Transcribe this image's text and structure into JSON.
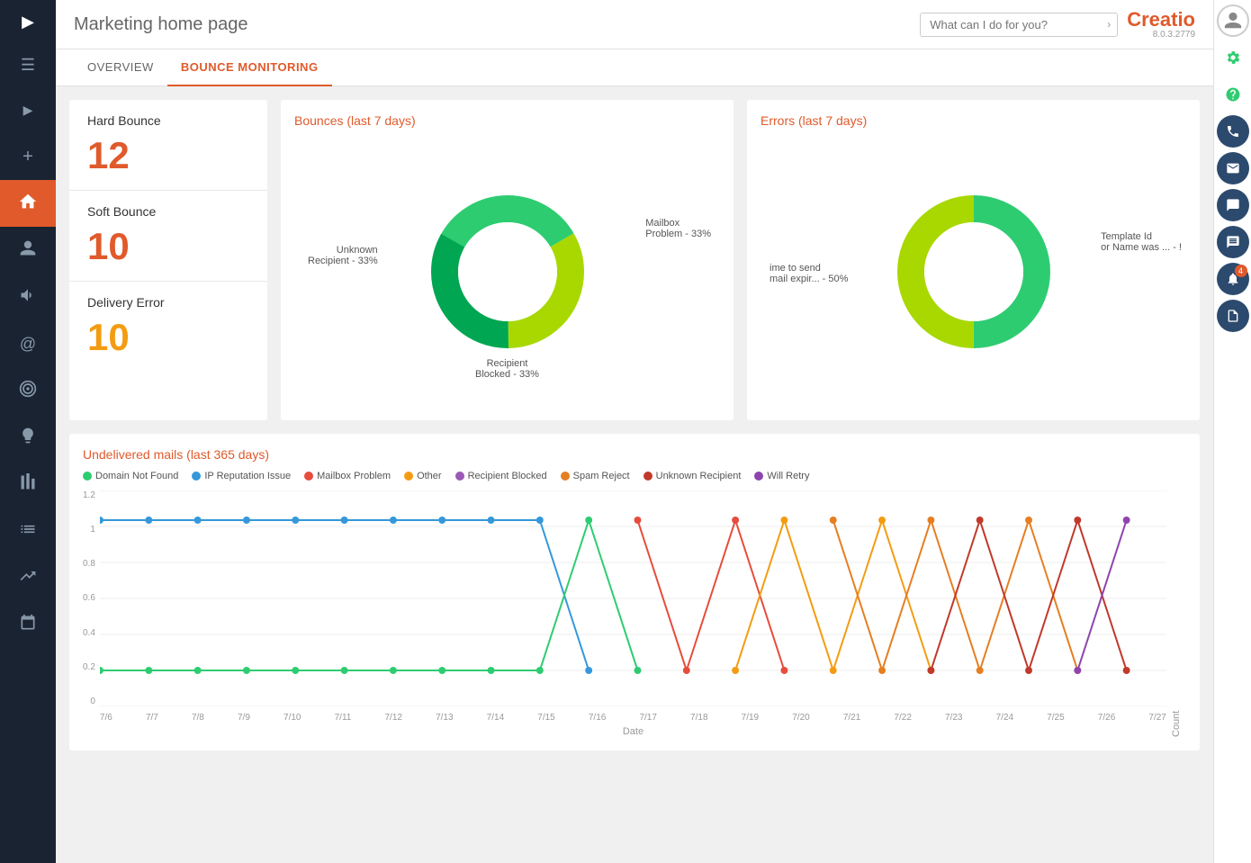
{
  "header": {
    "title": "Marketing home page",
    "search_placeholder": "What can I do for you?",
    "logo": "Creatio",
    "version": "8.0.3.2779"
  },
  "tabs": [
    {
      "label": "OVERVIEW",
      "active": false
    },
    {
      "label": "BOUNCE MONITORING",
      "active": true
    }
  ],
  "stats": [
    {
      "label": "Hard Bounce",
      "value": "12",
      "color": "red"
    },
    {
      "label": "Soft Bounce",
      "value": "10",
      "color": "red"
    },
    {
      "label": "Delivery Error",
      "value": "10",
      "color": "orange"
    }
  ],
  "bounces_chart": {
    "title": "Bounces (last 7 days)",
    "segments": [
      {
        "label": "Unknown Recipient - 33%",
        "color": "#2ecc71",
        "pct": 33
      },
      {
        "label": "Mailbox Problem - 33%",
        "color": "#a8d800",
        "pct": 33
      },
      {
        "label": "Recipient Blocked - 33%",
        "color": "#00a651",
        "pct": 34
      }
    ]
  },
  "errors_chart": {
    "title": "Errors (last 7 days)",
    "segments": [
      {
        "label": "ime to send mail expir... - 50%",
        "color": "#2ecc71",
        "pct": 50
      },
      {
        "label": "Template Id or Name was ... - !",
        "color": "#a8d800",
        "pct": 50
      }
    ]
  },
  "undelivered_chart": {
    "title": "Undelivered mails (last 365 days)",
    "y_label": "Count",
    "x_label": "Date",
    "y_ticks": [
      "0",
      "0.2",
      "0.4",
      "0.6",
      "0.8",
      "1",
      "1.2"
    ],
    "x_ticks": [
      "7/6",
      "7/7",
      "7/8",
      "7/9",
      "7/10",
      "7/11",
      "7/12",
      "7/13",
      "7/14",
      "7/15",
      "7/16",
      "7/17",
      "7/18",
      "7/19",
      "7/20",
      "7/21",
      "7/22",
      "7/23",
      "7/24",
      "7/25",
      "7/26",
      "7/27"
    ],
    "legend": [
      {
        "label": "Domain Not Found",
        "color": "#2ecc71"
      },
      {
        "label": "IP Reputation Issue",
        "color": "#3498db"
      },
      {
        "label": "Mailbox Problem",
        "color": "#e74c3c"
      },
      {
        "label": "Other",
        "color": "#f39c12"
      },
      {
        "label": "Recipient Blocked",
        "color": "#9b59b6"
      },
      {
        "label": "Spam Reject",
        "color": "#e67e22"
      },
      {
        "label": "Unknown Recipient",
        "color": "#c0392b"
      },
      {
        "label": "Will Retry",
        "color": "#8e44ad"
      }
    ]
  },
  "sidebar": {
    "items": [
      {
        "icon": "▶",
        "label": "expand"
      },
      {
        "icon": "☰",
        "label": "menu"
      },
      {
        "icon": "▶",
        "label": "play"
      },
      {
        "icon": "+",
        "label": "add"
      },
      {
        "icon": "⌂",
        "label": "home",
        "active": true
      },
      {
        "icon": "👤",
        "label": "user"
      },
      {
        "icon": "📢",
        "label": "marketing"
      },
      {
        "icon": "@",
        "label": "email"
      },
      {
        "icon": "🎯",
        "label": "target"
      },
      {
        "icon": "💡",
        "label": "ideas"
      },
      {
        "icon": "📊",
        "label": "reports1"
      },
      {
        "icon": "📋",
        "label": "reports2"
      },
      {
        "icon": "📈",
        "label": "analytics"
      },
      {
        "icon": "📅",
        "label": "calendar"
      }
    ]
  },
  "right_panel": {
    "items": [
      {
        "icon": "⚙",
        "label": "settings",
        "color": "green"
      },
      {
        "icon": "?",
        "label": "help",
        "color": "green"
      },
      {
        "icon": "📞",
        "label": "phone"
      },
      {
        "icon": "✉",
        "label": "email"
      },
      {
        "icon": "💬",
        "label": "chat"
      },
      {
        "icon": "💬",
        "label": "chat2"
      },
      {
        "icon": "🔔",
        "label": "notifications",
        "badge": "4"
      },
      {
        "icon": "📋",
        "label": "reports"
      }
    ]
  }
}
